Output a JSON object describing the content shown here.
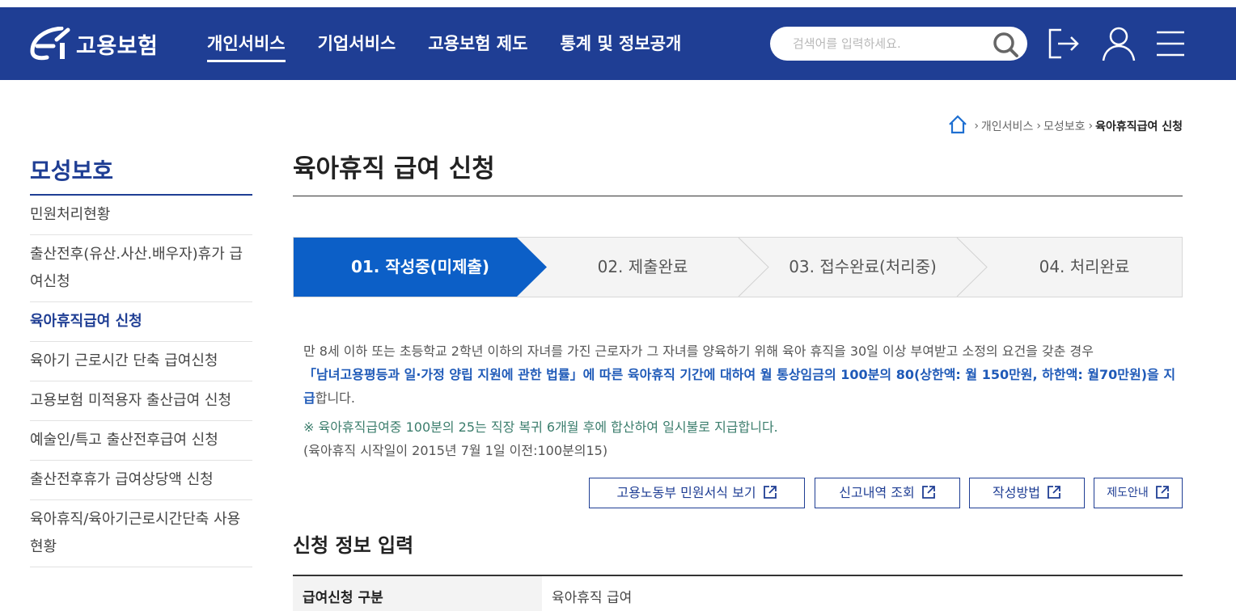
{
  "header": {
    "logo_text": "고용보험",
    "nav": [
      "개인서비스",
      "기업서비스",
      "고용보험 제도",
      "통계 및 정보공개"
    ],
    "search_placeholder": "검색어를 입력하세요."
  },
  "breadcrumb": {
    "items": [
      "개인서비스",
      "모성보호"
    ],
    "current": "육아휴직급여 신청"
  },
  "sidebar": {
    "title": "모성보호",
    "items": [
      "민원처리현황",
      "출산전후(유산.사산.배우자)휴가 급여신청",
      "육아휴직급여 신청",
      "육아기 근로시간 단축 급여신청",
      "고용보험 미적용자 출산급여 신청",
      "예술인/특고 출산전후급여 신청",
      "출산전후휴가 급여상당액 신청",
      "육아휴직/육아기근로시간단축 사용현황"
    ]
  },
  "main": {
    "title": "육아휴직 급여 신청",
    "steps": [
      "01. 작성중(미제출)",
      "02. 제출완료",
      "03. 접수완료(처리중)",
      "04. 처리완료"
    ],
    "desc_line1": "만 8세 이하 또는 초등학교 2학년 이하의 자녀를 가진 근로자가 그 자녀를 양육하기 위해 육아 휴직을 30일 이상 부여받고 소정의 요건을 갖춘 경우",
    "desc_emph": "「남녀고용평등과 일·가정 양립 지원에 관한 법률」에 따른 육아휴직 기간에 대하여 월 통상임금의 100분의 80(상한액: 월 150만원, 하한액: 월70만원)을 지급",
    "desc_tail": "합니다.",
    "note_line1": "※ 육아휴직급여중 100분의 25는 직장 복귀 6개월 후에 합산하여 일시불로 지급합니다.",
    "note_line2": "(육아휴직 시작일이 2015년 7월 1일 이전:100분의15)",
    "buttons": [
      "고용노동부 민원서식 보기",
      "신고내역 조회",
      "작성방법",
      "제도안내"
    ],
    "section_title": "신청 정보 입력",
    "form": {
      "label": "급여신청 구분",
      "value": "육아휴직 급여"
    }
  },
  "colors": {
    "brand": "#1f3e94",
    "step_active": "#0c5fc7",
    "emphasis": "#1f5ab8",
    "note": "#3b7d6c"
  }
}
